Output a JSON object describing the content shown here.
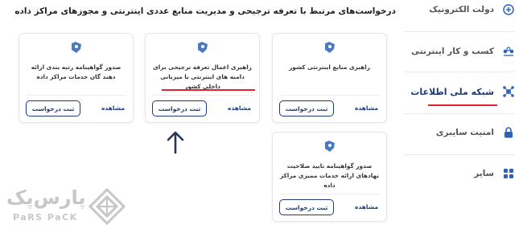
{
  "heading": "درخواست‌های مرتبط با تعرفه ترجیحی و مدیریت منابع عددی اینترنتی و مجوزهای مراکز داده",
  "nav": {
    "items": [
      {
        "label": "دولت الکترونیک",
        "icon": "gov-icon"
      },
      {
        "label": "کسب و کار اینترنتی",
        "icon": "business-icon"
      },
      {
        "label": "شبکه ملی اطلاعات",
        "icon": "network-icon",
        "active": true
      },
      {
        "label": "امنیت سایبری",
        "icon": "lock-icon"
      },
      {
        "label": "سایر",
        "icon": "grid-icon"
      }
    ]
  },
  "cards": [
    {
      "title": "راهبری منابع اینترنتی کشور",
      "button": "ثبت درخواست",
      "link": "مشاهده"
    },
    {
      "title": "راهبری اعمال تعرفه ترجیحی برای دامنه های اینترنتی با میزبانی داخلی کشور",
      "button": "ثبت درخواست",
      "link": "مشاهده"
    },
    {
      "title": "صدور گواهینامه رتبه بندی ارائه دهند گان خدمات مراکز داده",
      "button": "ثبت درخواست",
      "link": "مشاهده"
    },
    {
      "title": "صدور گواهینامه تایید صلاحیت نهادهای ارائه خدمات ممیزی مراکز داده",
      "button": "ثبت درخواست",
      "link": "مشاهده"
    }
  ],
  "logo": {
    "fa": "پارس‌پک",
    "en": "PaRS PaCK"
  },
  "colors": {
    "accent": "#1f3b77",
    "highlight": "#e0242f",
    "icon": "#2d63b4"
  }
}
